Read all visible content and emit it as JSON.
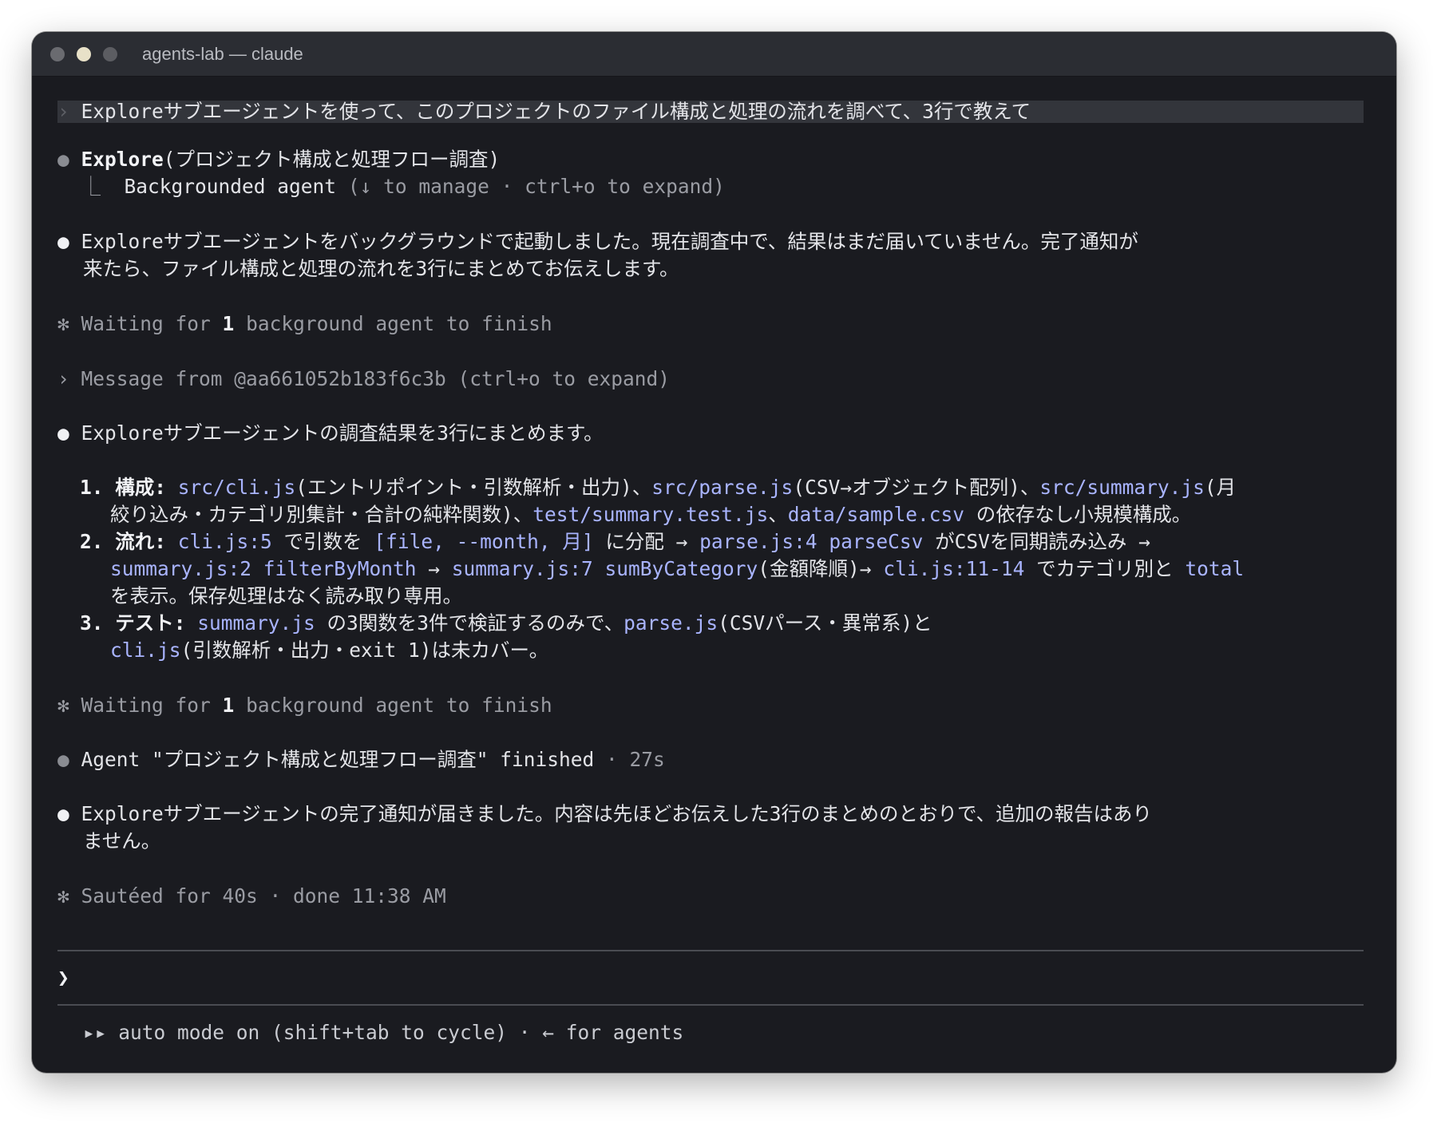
{
  "window": {
    "title": "agents-lab — claude"
  },
  "transcript": {
    "user_prompt": "Exploreサブエージェントを使って、このプロジェクトのファイル構成と処理の流れを調べて、3行で教えて",
    "tool_call": {
      "name": "Explore",
      "args": "(プロジェクト構成と処理フロー調査)",
      "sub_label": "Backgrounded agent",
      "sub_hint": "(↓ to manage · ctrl+o to expand)"
    },
    "reply1": {
      "line1": "Exploreサブエージェントをバックグラウンドで起動しました。現在調査中で、結果はまだ届いていません。完了通知が",
      "line2": "来たら、ファイル構成と処理の流れを3行にまとめてお伝えします。"
    },
    "waiting1": {
      "prefix": "Waiting for ",
      "count": "1",
      "suffix": " background agent to finish"
    },
    "message": {
      "text": "Message from @aa661052b183f6c3b (ctrl+o to expand)"
    },
    "reply2": {
      "intro": "Exploreサブエージェントの調査結果を3行にまとめます。"
    },
    "summary": [
      {
        "number": "1.",
        "label": "構成:",
        "segments": [
          {
            "t": "src/cli.js",
            "code": true
          },
          {
            "t": "(エントリポイント・引数解析・出力)、",
            "code": false
          },
          {
            "t": "src/parse.js",
            "code": true
          },
          {
            "t": "(CSV→オブジェクト配列)、",
            "code": false
          },
          {
            "t": "src/summary.js",
            "code": true
          },
          {
            "t": "(月",
            "code": false
          }
        ],
        "continuation": [
          [
            {
              "t": "絞り込み・カテゴリ別集計・合計の純粋関数)、",
              "code": false
            },
            {
              "t": "test/summary.test.js",
              "code": true
            },
            {
              "t": "、",
              "code": false
            },
            {
              "t": "data/sample.csv",
              "code": true
            },
            {
              "t": " の依存なし小規模構成。",
              "code": false
            }
          ]
        ]
      },
      {
        "number": "2.",
        "label": "流れ:",
        "segments": [
          {
            "t": "cli.js:5",
            "code": true
          },
          {
            "t": " で引数を ",
            "code": false
          },
          {
            "t": "[file, --month, 月]",
            "code": true
          },
          {
            "t": " に分配 → ",
            "code": false
          },
          {
            "t": "parse.js:4 parseCsv",
            "code": true
          },
          {
            "t": " がCSVを同期読み込み →",
            "code": false
          }
        ],
        "continuation": [
          [
            {
              "t": "summary.js:2 filterByMonth",
              "code": true
            },
            {
              "t": " → ",
              "code": false
            },
            {
              "t": "summary.js:7 sumByCategory",
              "code": true
            },
            {
              "t": "(金額降順)→ ",
              "code": false
            },
            {
              "t": "cli.js:11-14",
              "code": true
            },
            {
              "t": " でカテゴリ別と ",
              "code": false
            },
            {
              "t": "total",
              "code": true
            }
          ],
          [
            {
              "t": "を表示。保存処理はなく読み取り専用。",
              "code": false
            }
          ]
        ]
      },
      {
        "number": "3.",
        "label": "テスト:",
        "segments": [
          {
            "t": "summary.js",
            "code": true
          },
          {
            "t": " の3関数を3件で検証するのみで、",
            "code": false
          },
          {
            "t": "parse.js",
            "code": true
          },
          {
            "t": "(CSVパース・異常系)と",
            "code": false
          }
        ],
        "continuation": [
          [
            {
              "t": "cli.js",
              "code": true
            },
            {
              "t": "(引数解析・出力・exit 1)は未カバー。",
              "code": false
            }
          ]
        ]
      }
    ],
    "waiting2": {
      "prefix": "Waiting for ",
      "count": "1",
      "suffix": " background agent to finish"
    },
    "agent_finished": {
      "text": "Agent \"プロジェクト構成と処理フロー調査\" finished",
      "duration": " · 27s"
    },
    "reply3": {
      "line1": "Exploreサブエージェントの完了通知が届きました。内容は先ほどお伝えした3行のまとめのとおりで、追加の報告はあり",
      "line2": "ません。"
    },
    "done": {
      "text": "Sautéed for 40s · done 11:38 AM"
    }
  },
  "input": {
    "caret": "❯",
    "value": ""
  },
  "status_bar": {
    "text": "▸▸ auto mode on (shift+tab to cycle) · ← for agents"
  },
  "glyphs": {
    "prompt": "›",
    "bullet": "●",
    "tree": "⎿",
    "star": "✻"
  },
  "colors": {
    "background": "#1a1b20",
    "titlebar": "#2b2d33",
    "code": "#a9b4ff",
    "dim": "#9a9ca3"
  }
}
